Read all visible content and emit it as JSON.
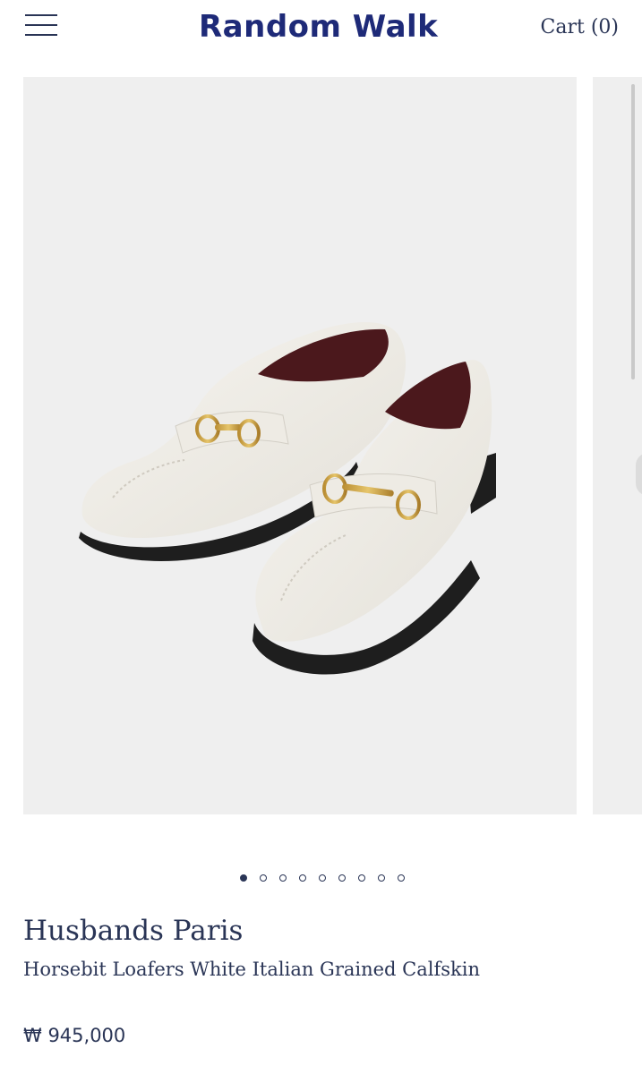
{
  "header": {
    "logo": "Random Walk",
    "cart_label": "Cart (0)",
    "menu_icon": "hamburger-menu-icon"
  },
  "carousel": {
    "slide_count": 9,
    "active_index": 0,
    "image_subject": "pair of white horsebit loafers with gold hardware",
    "colors": {
      "background": "#efefef",
      "shoe": "#f1efe9",
      "lining": "#5a1e22",
      "hardware": "#c9a24a"
    }
  },
  "product": {
    "brand": "Husbands Paris",
    "name": "Horsebit Loafers White Italian Grained Calfskin",
    "price": "₩ 945,000"
  },
  "colors": {
    "text": "#2a3556",
    "logo": "#1e2a78"
  }
}
